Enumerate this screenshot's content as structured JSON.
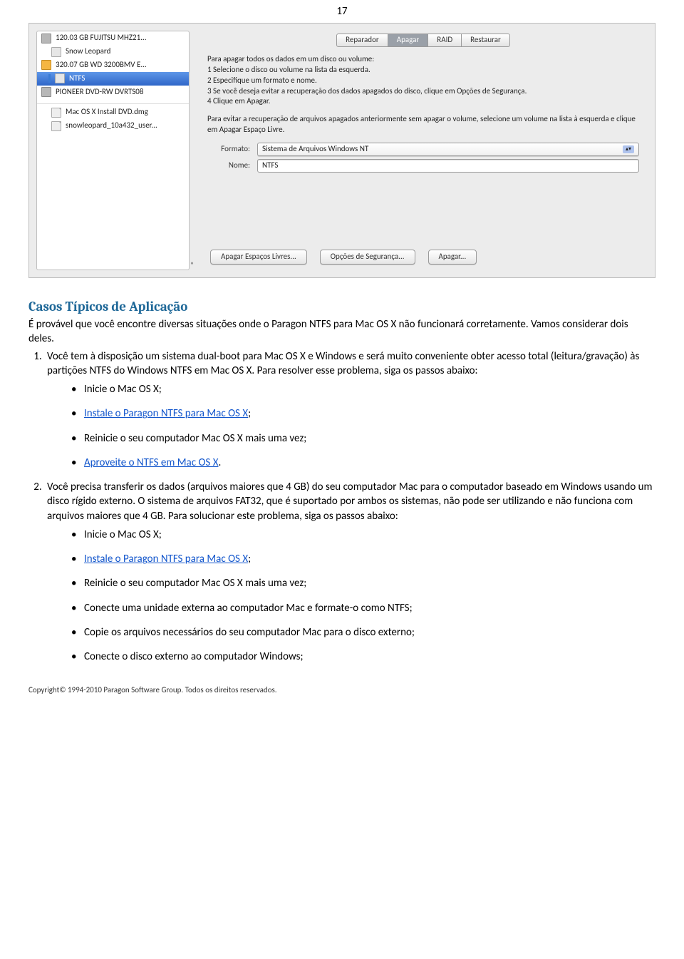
{
  "page_number": "17",
  "screenshot": {
    "sidebar": [
      {
        "icon": "hdd",
        "label": "120.03 GB FUJITSU MHZ21..."
      },
      {
        "icon": "vol",
        "label": "Snow Leopard"
      },
      {
        "icon": "hddy",
        "label": "320.07 GB WD 3200BMV E..."
      },
      {
        "icon": "vol",
        "label": "NTFS",
        "selected": true
      },
      {
        "icon": "hdd",
        "label": "PIONEER DVD-RW DVRTS08"
      },
      {
        "sep": true
      },
      {
        "icon": "dmg",
        "label": "Mac OS X Install DVD.dmg"
      },
      {
        "icon": "dmg",
        "label": "snowleopard_10a432_user..."
      }
    ],
    "tabs": [
      "Reparador",
      "Apagar",
      "RAID",
      "Restaurar"
    ],
    "active_tab": 1,
    "instr_title": "Para apagar todos os dados em um disco ou volume:",
    "instr_lines": [
      "1 Selecione o disco ou volume na lista da esquerda.",
      "2 Especifique um formato e nome.",
      "3 Se você deseja evitar a recuperação dos dados apagados do disco, clique em Opções de Segurança.",
      "4 Clique em Apagar."
    ],
    "instr_note": "Para evitar a recuperação de arquivos apagados anteriormente sem apagar o volume, selecione um volume na lista à esquerda e clique em Apagar Espaço Livre.",
    "format_label": "Formato:",
    "format_value": "Sistema de Arquivos Windows NT",
    "name_label": "Nome:",
    "name_value": "NTFS",
    "buttons": [
      "Apagar Espaços Livres...",
      "Opções de Segurança...",
      "Apagar..."
    ]
  },
  "section_title": "Casos Típicos de Aplicação",
  "intro": "É provável que você encontre diversas situações onde o Paragon NTFS para Mac OS X não funcionará corretamente. Vamos considerar dois deles.",
  "case1": {
    "text_before": "Você tem à disposição um sistema dual-boot para Mac OS X e Windows e será muito conveniente obter acesso total (leitura/gravação) às partições NTFS do Windows NTFS em Mac OS X. Para resolver esse problema, siga os passos abaixo:",
    "bullets": [
      {
        "plain": "Inicie o Mac OS X;"
      },
      {
        "link": "Instale o Paragon NTFS para Mac OS X",
        "suffix": ";"
      },
      {
        "plain": "Reinicie o seu computador Mac OS X mais uma vez;"
      },
      {
        "link": "Aproveite o NTFS em Mac OS X",
        "suffix": "."
      }
    ]
  },
  "case2": {
    "text_before": "Você precisa transferir os dados (arquivos maiores que 4 GB) do seu computador Mac para o computador baseado em Windows usando um disco rígido externo. O sistema de arquivos FAT32, que é suportado por ambos os sistemas, não pode ser utilizando e não funciona com arquivos maiores que 4 GB. Para solucionar este problema, siga os passos abaixo:",
    "bullets": [
      {
        "plain": "Inicie o Mac OS X;"
      },
      {
        "link": "Instale o Paragon NTFS para Mac OS X",
        "suffix": ";"
      },
      {
        "plain": "Reinicie o seu computador Mac OS X mais uma vez;"
      },
      {
        "plain": "Conecte uma unidade externa ao computador Mac e formate-o como NTFS;"
      },
      {
        "plain": "Copie os arquivos necessários do seu computador Mac para o disco externo;"
      },
      {
        "plain": "Conecte o disco externo ao computador Windows;"
      }
    ]
  },
  "footer": "Copyright© 1994-2010 Paragon Software Group. Todos os direitos reservados."
}
